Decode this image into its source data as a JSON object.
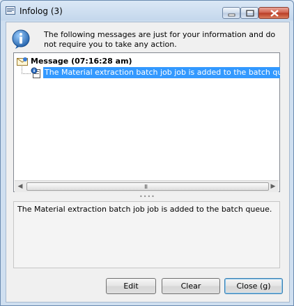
{
  "window": {
    "title": "Infolog (3)",
    "icon": "infolog-app-icon",
    "controls": [
      "minimize-icon",
      "maximize-icon",
      "close-icon"
    ]
  },
  "info": {
    "icon": "info-icon",
    "text": "The following messages are just for your information and do not require you to take any action."
  },
  "tree": {
    "header_label": "Message (07:16:28 am)",
    "header_icon": "envelope-icon",
    "items": [
      {
        "icon": "info-document-icon",
        "label": "The Material extraction batch job job is added to the batch queue."
      }
    ],
    "scrollbar_grip": "III"
  },
  "splitter": "••••",
  "detail": {
    "text": "The Material extraction batch job job is added to the batch queue."
  },
  "buttons": {
    "edit": "Edit",
    "clear": "Clear",
    "close": "Close (g)"
  },
  "colors": {
    "selection": "#3399ff",
    "window_frame": "#c4d7ec"
  }
}
